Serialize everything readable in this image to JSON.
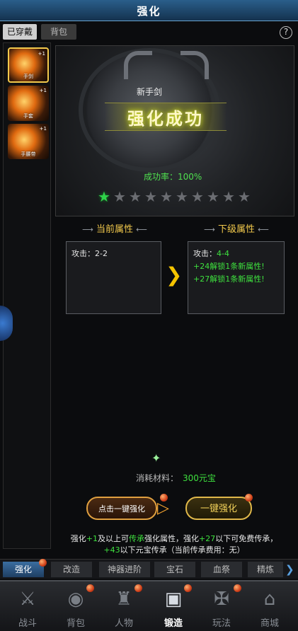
{
  "title": "强化",
  "top_tabs": {
    "worn": "已穿戴",
    "bag": "背包"
  },
  "help_icon": "?",
  "equipment": [
    {
      "label": "手剑",
      "plus": "+1"
    },
    {
      "label": "手套",
      "plus": "+1"
    },
    {
      "label": "手腰带",
      "plus": "+1"
    }
  ],
  "item": {
    "name": "新手剑",
    "result": "强化成功",
    "rate": "成功率：100%",
    "stars_total": 10,
    "stars_lit": 1
  },
  "current": {
    "header": "当前属性",
    "lines": [
      {
        "label": "攻击：",
        "value": "2-2"
      }
    ]
  },
  "next": {
    "header": "下级属性",
    "attack_label": "攻击：",
    "attack_value": "4-4",
    "unlock_1": "+24解锁1条新属性!",
    "unlock_2": "+27解锁1条新属性!"
  },
  "material": {
    "label": "消耗材料：",
    "value": "300元宝"
  },
  "buttons": {
    "click_one": "点击一键强化",
    "one_key": "一键强化"
  },
  "tips": {
    "p1": "强化",
    "g1": "+1",
    "p2": "及以上可",
    "g2": "传承",
    "p3": "强化属性，强化",
    "g3": "+27",
    "p4": "以下可免费传承，",
    "g4": "+43",
    "p5": "以下元宝传承（当前传承费用：无）"
  },
  "subtabs": [
    "强化",
    "改造",
    "神器进阶",
    "宝石",
    "血祭",
    "精炼"
  ],
  "nav": [
    {
      "label": "战斗",
      "icon": "crossed-swords-icon"
    },
    {
      "label": "背包",
      "icon": "bag-icon"
    },
    {
      "label": "人物",
      "icon": "character-icon"
    },
    {
      "label": "锻造",
      "icon": "anvil-icon"
    },
    {
      "label": "玩法",
      "icon": "gameplay-icon"
    },
    {
      "label": "商城",
      "icon": "shop-icon"
    }
  ],
  "colors": {
    "accent_gold": "#f2c94c",
    "success_green": "#3ee03e",
    "title_blue": "#2a5e8a"
  }
}
